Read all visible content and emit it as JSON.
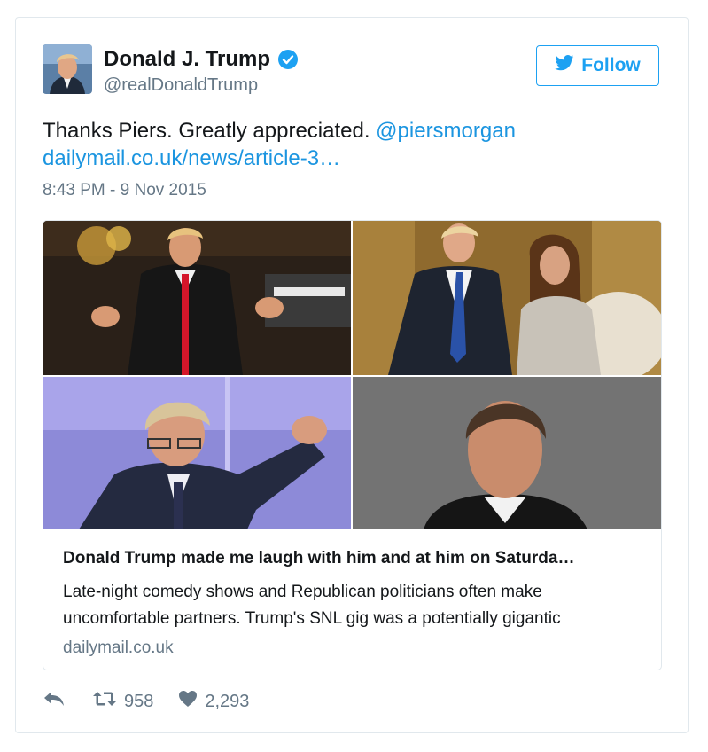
{
  "tweet": {
    "author": {
      "display_name": "Donald J. Trump",
      "screen_name": "@realDonaldTrump",
      "verified": true
    },
    "follow_button": {
      "label": "Follow"
    },
    "text": {
      "body": "Thanks Piers. Greatly appreciated. ",
      "mention": "@piersmorgan",
      "link": "dailymail.co.uk/news/article-3…"
    },
    "timestamp": "8:43 PM - 9 Nov 2015",
    "card": {
      "title": "Donald Trump made me laugh with him and at him on Saturda…",
      "description_line1": "Late-night comedy shows and Republican politicians often make",
      "description_line2": "uncomfortable partners. Trump's SNL gig was a potentially gigantic",
      "domain": "dailymail.co.uk"
    },
    "actions": {
      "reply_icon": "reply-icon",
      "retweet_icon": "retweet-icon",
      "retweet_count": "958",
      "like_icon": "heart-icon",
      "like_count": "2,293"
    },
    "colors": {
      "link": "#1b95e0",
      "follow_accent": "#1da1f2",
      "muted": "#657786",
      "text": "#14171a",
      "border": "#e1e8ed"
    }
  }
}
